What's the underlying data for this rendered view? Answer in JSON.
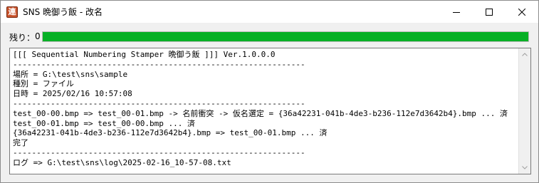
{
  "window": {
    "title": "SNS 晩御う飯 - 改名",
    "app_icon_glyph": "連",
    "controls": [
      "minimize-icon",
      "maximize-icon",
      "close-icon"
    ]
  },
  "progress": {
    "label": "残り：",
    "remaining": "0",
    "fraction": 1.0,
    "color": "#06b025"
  },
  "log": {
    "lines": [
      "[[[ Sequential Numbering Stamper 晩御う飯 ]]] Ver.1.0.0.0",
      "--------------------------------------------------------------",
      "場所 = G:\\test\\sns\\sample",
      "種別 = ファイル",
      "日時 = 2025/02/16 10:57:08",
      "--------------------------------------------------------------",
      "test_00-00.bmp => test_00-01.bmp -> 名前衝突 -> 仮名選定 = {36a42231-041b-4de3-b236-112e7d3642b4}.bmp ... 済",
      "test_00-01.bmp => test_00-00.bmp ... 済",
      "{36a42231-041b-4de3-b236-112e7d3642b4}.bmp => test_00-01.bmp ... 済",
      "完了",
      "--------------------------------------------------------------",
      "ログ => G:\\test\\sns\\log\\2025-02-16_10-57-08.txt"
    ]
  }
}
